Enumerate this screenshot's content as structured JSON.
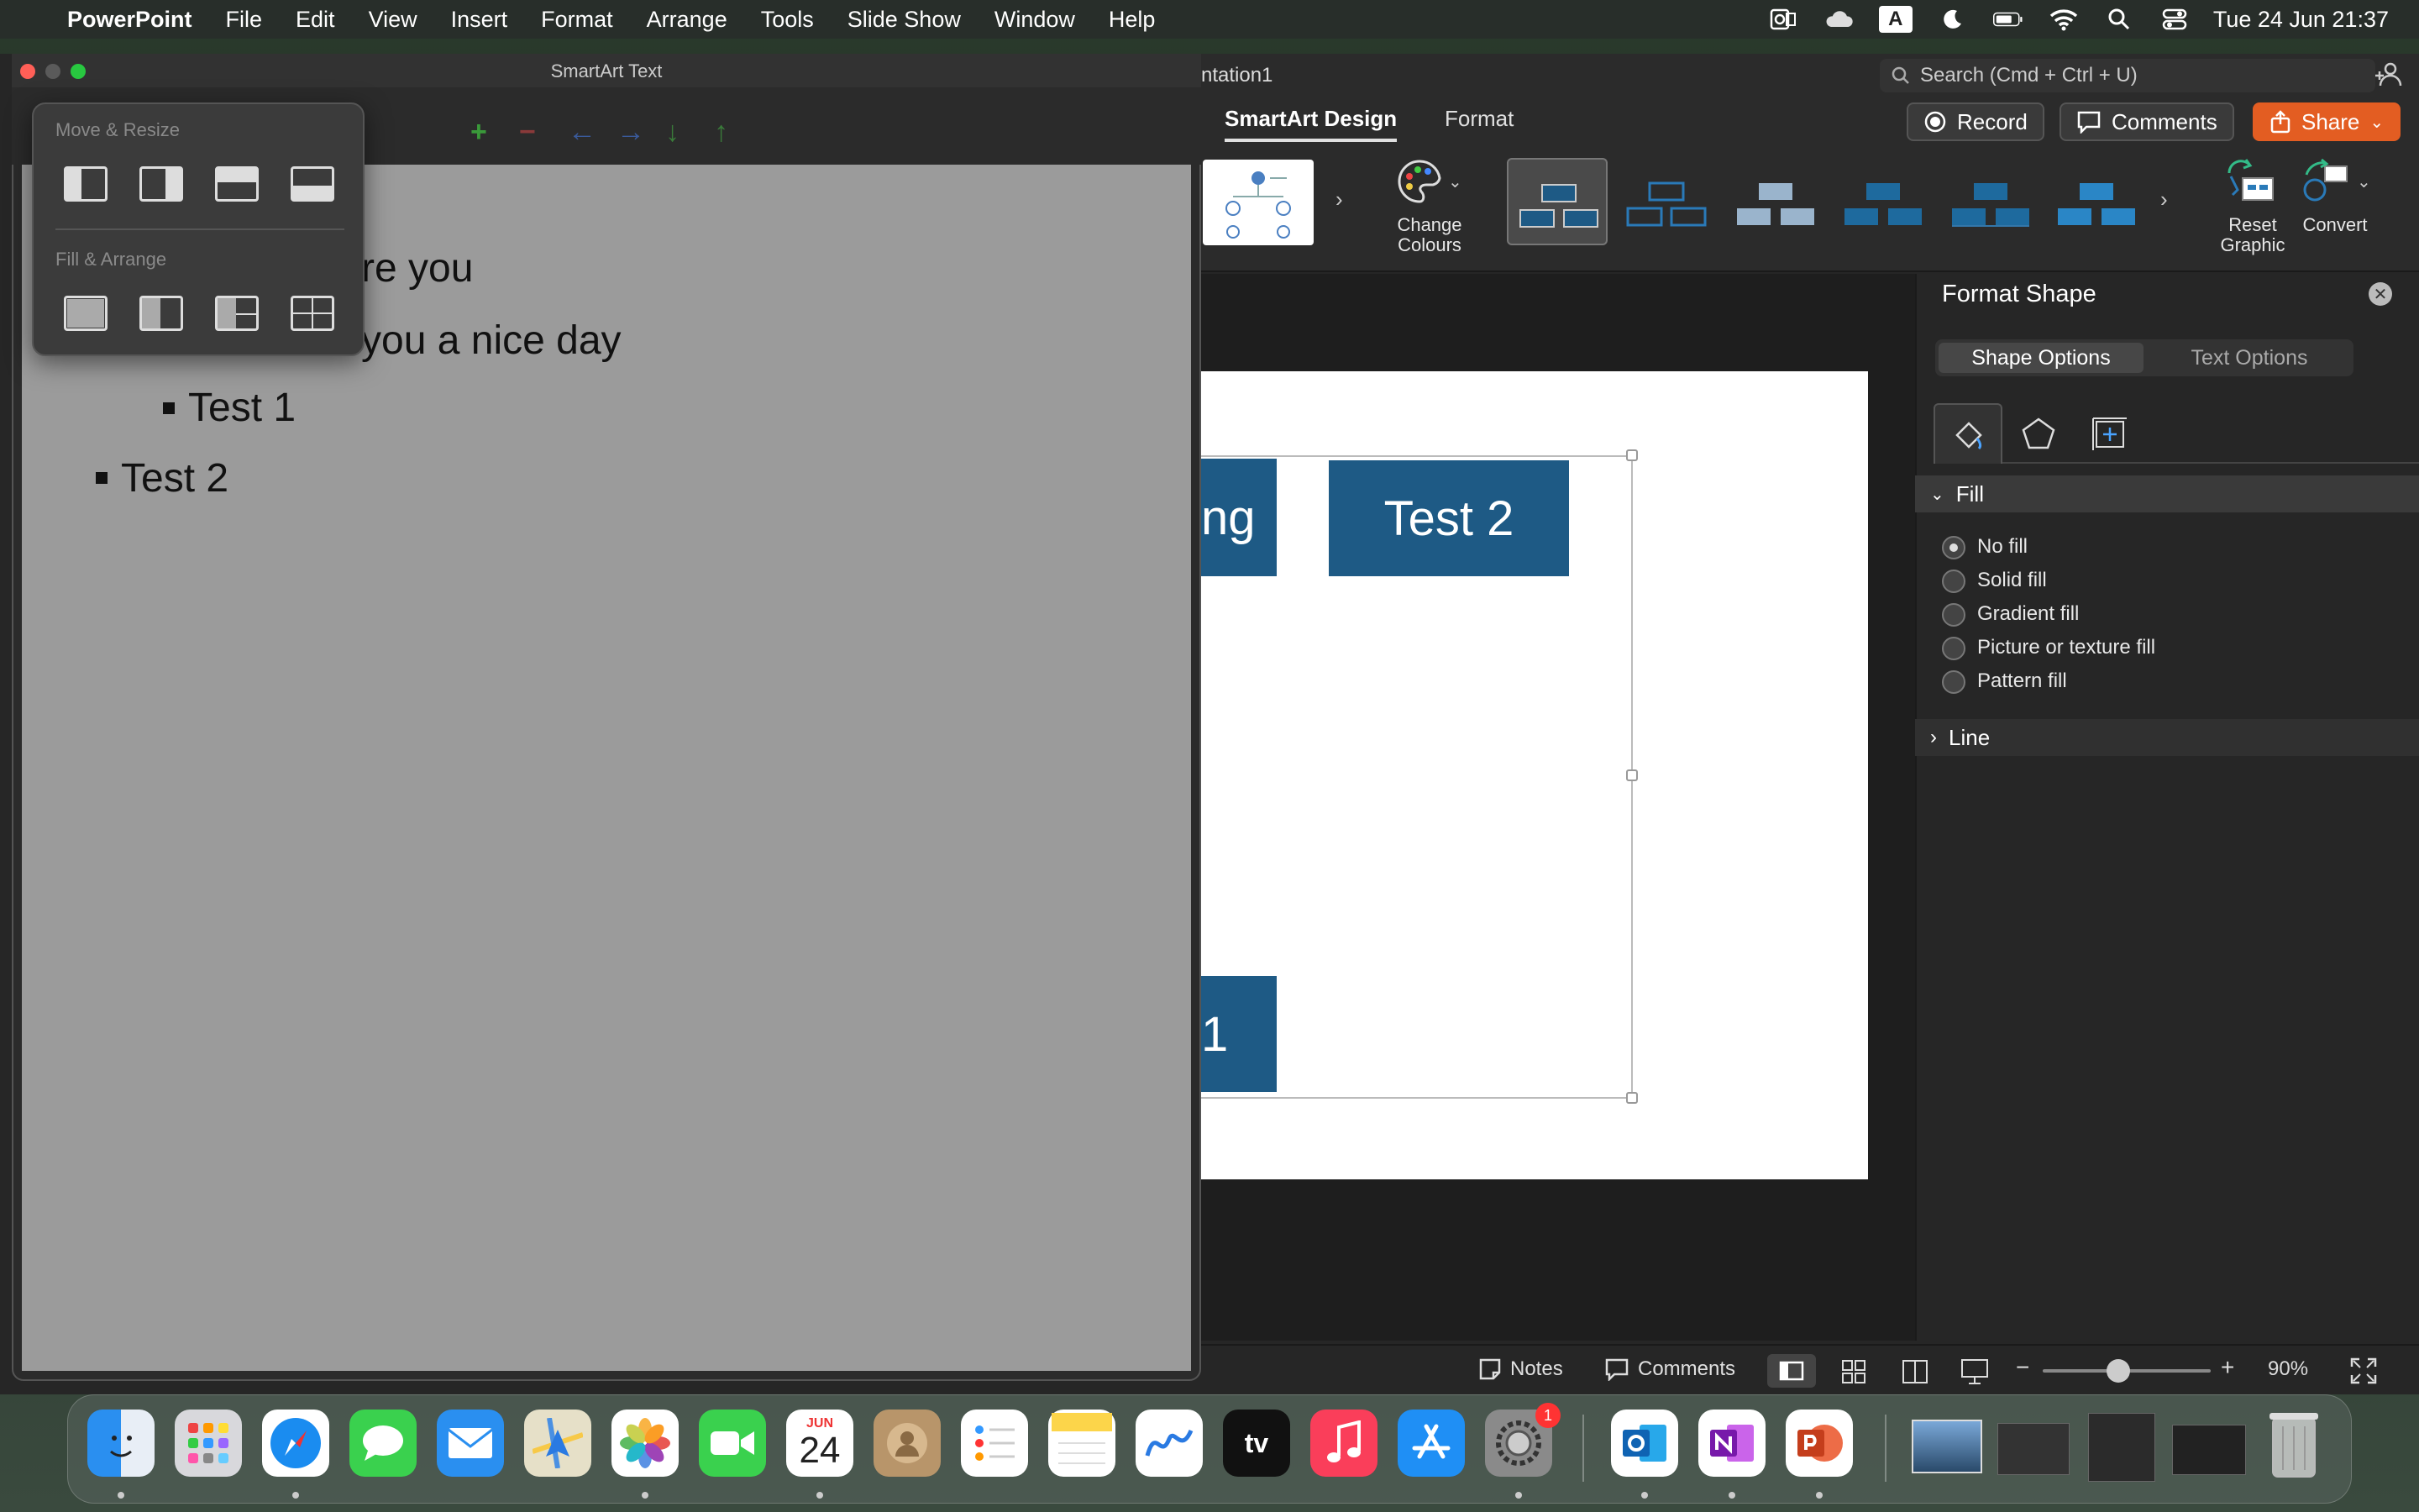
{
  "menubar": {
    "apple": "",
    "app_name": "PowerPoint",
    "items": [
      "File",
      "Edit",
      "View",
      "Insert",
      "Format",
      "Arrange",
      "Tools",
      "Slide Show",
      "Window",
      "Help"
    ],
    "clock": "Tue 24 Jun  21:37",
    "input_badge": "A"
  },
  "ppt_window": {
    "title_fragment": "ntation1",
    "search_placeholder": "Search (Cmd + Ctrl + U)",
    "tabs": [
      "SmartArt Design",
      "Format"
    ],
    "record_label": "Record",
    "comments_label": "Comments",
    "share_label": "Share",
    "change_colours_label": "Change\nColours",
    "reset_graphic_label": "Reset\nGraphic",
    "convert_label": "Convert"
  },
  "slide": {
    "box1_text": "ng",
    "box2_text": "Test 2",
    "box3_text": "1"
  },
  "format_pane": {
    "title": "Format Shape",
    "tab_shape": "Shape Options",
    "tab_text": "Text Options",
    "fill_section": "Fill",
    "line_section": "Line",
    "fill_options": [
      "No fill",
      "Solid fill",
      "Gradient fill",
      "Picture or texture fill",
      "Pattern fill"
    ],
    "selected_fill": "No fill"
  },
  "status_bar": {
    "notes": "Notes",
    "comments": "Comments",
    "zoom": "90%"
  },
  "smartart_window": {
    "title": "SmartArt Text",
    "lines": [
      {
        "text": "re you"
      },
      {
        "text": "you a nice day"
      },
      {
        "text": "Test 1"
      },
      {
        "text": "Test 2"
      }
    ]
  },
  "popover": {
    "move_resize_label": "Move & Resize",
    "fill_arrange_label": "Fill & Arrange"
  },
  "dock": {
    "calendar_month": "JUN",
    "calendar_day": "24",
    "settings_badge": "1",
    "apps": [
      "Finder",
      "Launchpad",
      "Safari",
      "Messages",
      "Mail",
      "Maps",
      "Photos",
      "FaceTime",
      "Calendar",
      "Contacts",
      "Reminders",
      "Notes",
      "Freeform",
      "TV",
      "Music",
      "App Store",
      "System Settings",
      "Outlook",
      "OneNote",
      "PowerPoint"
    ]
  },
  "colors": {
    "smartart_fill": "#1e5a85",
    "share_button": "#e35d22",
    "menubar_bg": "#282e2a"
  }
}
